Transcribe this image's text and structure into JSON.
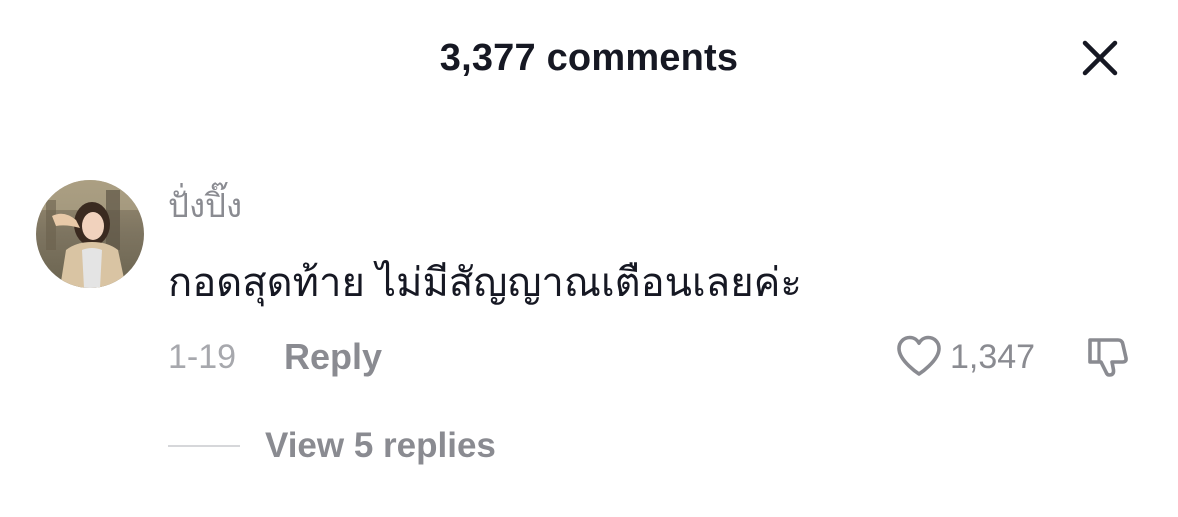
{
  "header": {
    "title": "3,377 comments",
    "close_icon": "close-icon"
  },
  "comment": {
    "username": "ปั่งปิ๊ง",
    "text": "กอดสุดท้าย ไม่มีสัญญาณเตือนเลยค่ะ",
    "date": "1-19",
    "reply_label": "Reply",
    "like_count": "1,347",
    "like_icon": "heart-outline-icon",
    "dislike_icon": "thumbs-down-icon",
    "avatar_icon": "user-avatar"
  },
  "replies": {
    "view_label": "View 5 replies"
  },
  "colors": {
    "primary_text": "#161823",
    "secondary_text": "#8a8b91",
    "date_text": "#a7a8ad",
    "divider": "#d6d7da",
    "background": "#ffffff"
  }
}
